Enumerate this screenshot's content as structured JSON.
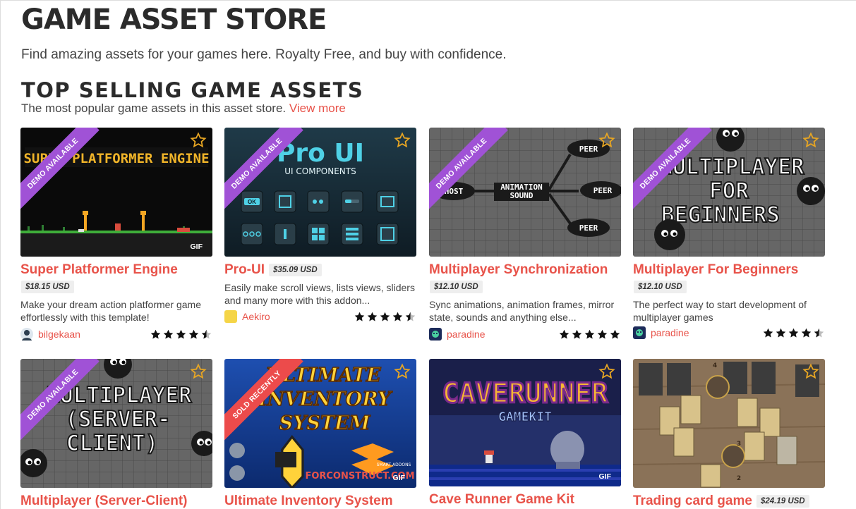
{
  "header": {
    "title": "GAME ASSET STORE",
    "subtitle": "Find amazing assets for your games here. Royalty Free, and buy with confidence."
  },
  "section": {
    "title": "TOP SELLING GAME ASSETS",
    "subtitle": "The most popular game assets in this asset store.",
    "view_more": "View more"
  },
  "colors": {
    "accent": "#e8534a",
    "demo_ribbon": "#a052d6",
    "sold_ribbon": "#ec4b4b",
    "star_outline": "#e8a623"
  },
  "cards": [
    {
      "title": "Super Platformer Engine",
      "price": "$18.15 USD",
      "desc": "Make your dream action platformer game effortlessly with this template!",
      "author": "bilgekaan",
      "rating": 4.5,
      "ribbon": "DEMO AVAILABLE",
      "gif": "GIF",
      "art_text": "SUPER PLATFORMER ENGINE"
    },
    {
      "title": "Pro-UI",
      "price": "$35.09 USD",
      "desc": "Easily make scroll views, lists views, sliders and many more with this addon...",
      "author": "Aekiro",
      "rating": 4.5,
      "ribbon": "DEMO AVAILABLE",
      "art_text": "Pro UI",
      "art_sub": "UI COMPONENTS",
      "art_btn": "OK"
    },
    {
      "title": "Multiplayer Synchronization",
      "price": "$12.10 USD",
      "desc": "Sync animations, animation frames, mirror state, sounds and anything else...",
      "author": "paradine",
      "rating": 5,
      "ribbon": "DEMO AVAILABLE",
      "art_labels": [
        "HOST",
        "ANIMATION",
        "SOUND",
        "PEER",
        "PEER",
        "PEER"
      ]
    },
    {
      "title": "Multiplayer For Beginners",
      "price": "$12.10 USD",
      "desc": "The perfect way to start development of multiplayer games",
      "author": "paradine",
      "rating": 4.5,
      "ribbon": "DEMO AVAILABLE",
      "art_lines": [
        "MULTIPLAYER",
        "FOR",
        "BEGINNERS"
      ]
    },
    {
      "title": "Multiplayer (Server-Client)",
      "ribbon": "DEMO AVAILABLE",
      "art_lines": [
        "MULTIPLAYER",
        "(SERVER-",
        "CLIENT)"
      ]
    },
    {
      "title": "Ultimate Inventory System",
      "ribbon": "SOLD RECENTLY",
      "gif": "GIF",
      "art_lines": [
        "ULTIMATE",
        "INVENTORY",
        "SYSTEM"
      ],
      "art_brand": "FORCONSTRUCT.COM",
      "art_brand_sub": "SMART ADDONS"
    },
    {
      "title": "Cave Runner Game Kit",
      "gif": "GIF",
      "art_lines": [
        "CAVERUNNER",
        "GAMEKIT"
      ]
    },
    {
      "title": "Trading card game",
      "price": "$24.19 USD",
      "art_numbers": [
        "4",
        "3",
        "2"
      ]
    }
  ]
}
